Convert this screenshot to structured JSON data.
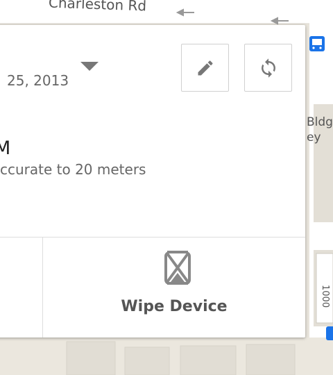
{
  "map": {
    "street_label": "Charleston Rd",
    "building_label_1": "Bldg",
    "building_label_2": "ey",
    "number_label": "1000",
    "transit_icon": "bus-icon"
  },
  "device_card": {
    "date_partial": "25, 2013",
    "time_partial": "M",
    "accuracy_partial": "ccurate to 20 meters",
    "edit_icon": "pencil-icon",
    "refresh_icon": "refresh-icon",
    "wipe_label": "Wipe Device",
    "wipe_icon": "wipe-phone-icon"
  }
}
